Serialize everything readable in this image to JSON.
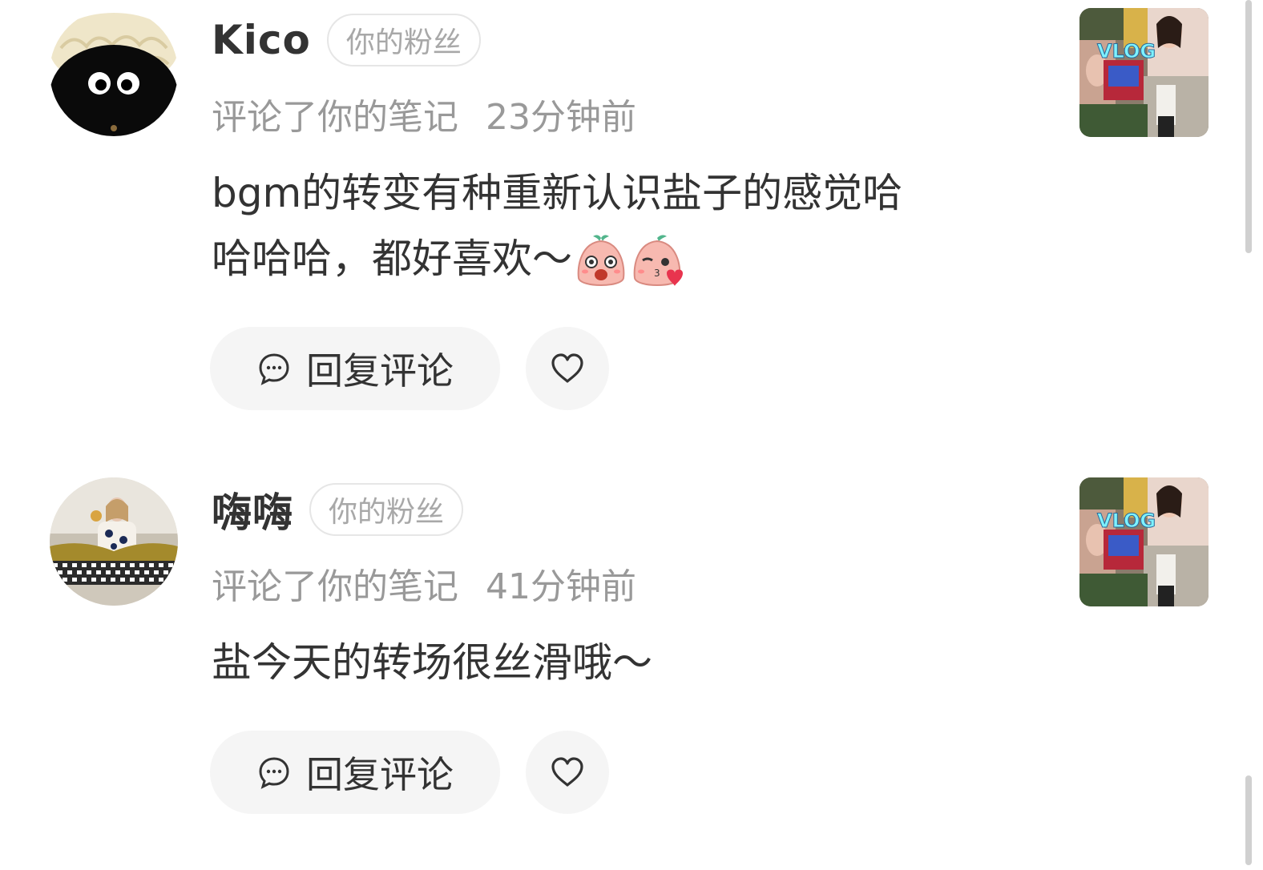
{
  "notifications": [
    {
      "username": "Kico",
      "badge": "你的粉丝",
      "action": "评论了你的笔记",
      "time": "23分钟前",
      "comment_line1": "bgm的转变有种重新认识盐子的感觉哈",
      "comment_line2": "哈哈哈，都好喜欢～",
      "reply_label": "回复评论",
      "thumbnail_text": "VLOG"
    },
    {
      "username": "嗨嗨",
      "badge": "你的粉丝",
      "action": "评论了你的笔记",
      "time": "41分钟前",
      "comment_line1": "盐今天的转场很丝滑哦～",
      "reply_label": "回复评论",
      "thumbnail_text": "VLOG"
    }
  ],
  "icons": {
    "reply": "chat-bubble-icon",
    "like": "heart-outline-icon"
  },
  "colors": {
    "primary_text": "#333333",
    "secondary_text": "#999999",
    "badge_text": "#a8a8a8",
    "button_bg": "#f5f5f5"
  }
}
